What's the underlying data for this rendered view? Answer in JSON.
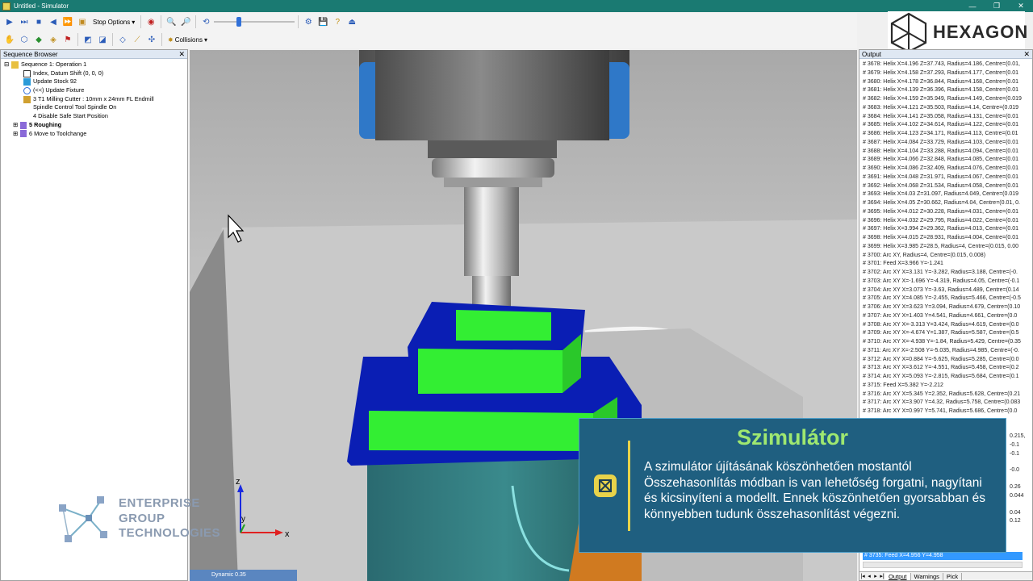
{
  "window": {
    "title": "Untitled - Simulator",
    "controls": [
      "—",
      "❐",
      "✕"
    ]
  },
  "toolbar1": {
    "stop_options_label": "Stop Options"
  },
  "toolbar2": {
    "collisions_label": "Collisions"
  },
  "brand": {
    "name": "HEXAGON"
  },
  "sequence_browser": {
    "title": "Sequence Browser",
    "items": [
      "Sequence 1: Operation 1",
      "Index, Datum Shift (0, 0, 0)",
      "Update Stock 92",
      "(<<) Update Fixture",
      "3 T1 Milling Cutter : 10mm x 24mm FL Endmill",
      "Spindle Control Tool Spindle On",
      "4 Disable Safe Start Position",
      "5 Roughing",
      "6 Move to Toolchange"
    ]
  },
  "output": {
    "title": "Output",
    "lines": [
      "# 3678: Helix X=4.196 Z=37.743, Radius=4.186, Centre=(0.01,",
      "# 3679: Helix X=4.158 Z=37.293, Radius=4.177, Centre=(0.01",
      "# 3680: Helix X=4.178 Z=36.844, Radius=4.168, Centre=(0.01",
      "# 3681: Helix X=4.139 Z=36.396, Radius=4.158, Centre=(0.01",
      "# 3682: Helix X=4.159 Z=35.949, Radius=4.149, Centre=(0.019",
      "# 3683: Helix X=4.121 Z=35.503, Radius=4.14, Centre=(0.019",
      "# 3684: Helix X=4.141 Z=35.058, Radius=4.131, Centre=(0.01",
      "# 3685: Helix X=4.102 Z=34.614, Radius=4.122, Centre=(0.01",
      "# 3686: Helix X=4.123 Z=34.171, Radius=4.113, Centre=(0.01",
      "# 3687: Helix X=4.084 Z=33.729, Radius=4.103, Centre=(0.01",
      "# 3688: Helix X=4.104 Z=33.288, Radius=4.094, Centre=(0.01",
      "# 3689: Helix X=4.066 Z=32.848, Radius=4.085, Centre=(0.01",
      "# 3690: Helix X=4.086 Z=32.409, Radius=4.076, Centre=(0.01",
      "# 3691: Helix X=4.048 Z=31.971, Radius=4.067, Centre=(0.01",
      "# 3692: Helix X=4.068 Z=31.534, Radius=4.058, Centre=(0.01",
      "# 3693: Helix X=4.03 Z=31.097, Radius=4.049, Centre=(0.019",
      "# 3694: Helix X=4.05 Z=30.662, Radius=4.04, Centre=(0.01, 0.",
      "# 3695: Helix X=4.012 Z=30.228, Radius=4.031, Centre=(0.01",
      "# 3696: Helix X=4.032 Z=29.795, Radius=4.022, Centre=(0.01",
      "# 3697: Helix X=3.994 Z=29.362, Radius=4.013, Centre=(0.01",
      "# 3698: Helix X=4.015 Z=28.931, Radius=4.004, Centre=(0.01",
      "# 3699: Helix X=3.985 Z=28.5, Radius=4, Centre=(0.015, 0.00",
      "# 3700: Arc XY, Radius=4, Centre=(0.015, 0.008)",
      "# 3701: Feed X=3.966 Y=-1.241",
      "# 3702: Arc XY X=3.131 Y=-3.282, Radius=3.188, Centre=(-0.",
      "# 3703: Arc XY X=-1.696 Y=-4.319, Radius=4.05, Centre=(-0.1",
      "# 3704: Arc XY X=3.073 Y=-3.63, Radius=4.489, Centre=(0.14",
      "# 3705: Arc XY X=4.085 Y=-2.455, Radius=5.466, Centre=(-0.5",
      "# 3706: Arc XY X=3.623 Y=3.094, Radius=4.679, Centre=(0.10",
      "# 3707: Arc XY X=1.403 Y=4.541, Radius=4.661, Centre=(0.0",
      "# 3708: Arc XY X=-3.313 Y=3.424, Radius=4.619, Centre=(0.0",
      "# 3709: Arc XY X=-4.674 Y=1.387, Radius=5.587, Centre=(0.5",
      "# 3710: Arc XY X=-4.938 Y=-1.84, Radius=5.429, Centre=(0.35",
      "# 3711: Arc XY X=-2.508 Y=-5.035, Radius=4.985, Centre=(-0.",
      "# 3712: Arc XY X=0.884 Y=-5.625, Radius=5.285, Centre=(0.0",
      "# 3713: Arc XY X=3.612 Y=-4.551, Radius=5.458, Centre=(0.2",
      "# 3714: Arc XY X=5.093 Y=-2.815, Radius=5.684, Centre=(0.1",
      "# 3715: Feed X=5.382 Y=-2.212",
      "# 3716: Arc XY X=5.345 Y=2.352, Radius=5.628, Centre=(0.21",
      "# 3717: Arc XY X=3.907 Y=4.32, Radius=5.758, Centre=(0.083",
      "# 3718: Arc XY X=0.997 Y=5.741, Radius=5.686, Centre=(0.0"
    ],
    "right_fragments": [
      "0.215,",
      "-0.1",
      "-0.1",
      "-0.0",
      "0.26",
      "0.044",
      "0.04",
      "0.12"
    ],
    "selected_line": "# 3735: Feed X=4.956 Y=4.958",
    "tabs": [
      "Output",
      "Warnings",
      "Pick"
    ]
  },
  "viewport": {
    "axis_x": "x",
    "axis_y": "y",
    "axis_z": "z",
    "status": "Dynamic 0.35"
  },
  "callout": {
    "title": "Szimulátor",
    "body": "A szimulátor újításának köszönhetően mostantól Összehasonlítás módban is van lehetőség forgatni, nagyítani és kicsinyíteni a modellt. Ennek köszönhetően gyorsabban és könnyebben tudunk összehasonlítást végezni."
  },
  "watermark": {
    "line1": "ENTERPRISE",
    "line2": "GROUP",
    "line3": "TECHNOLOGIES"
  },
  "colors": {
    "titlebar": "#1a7a72",
    "part_green": "#33ee33",
    "part_blue": "#0a1eb4",
    "callout_bg": "#1f5f80",
    "callout_title": "#9fe870"
  }
}
